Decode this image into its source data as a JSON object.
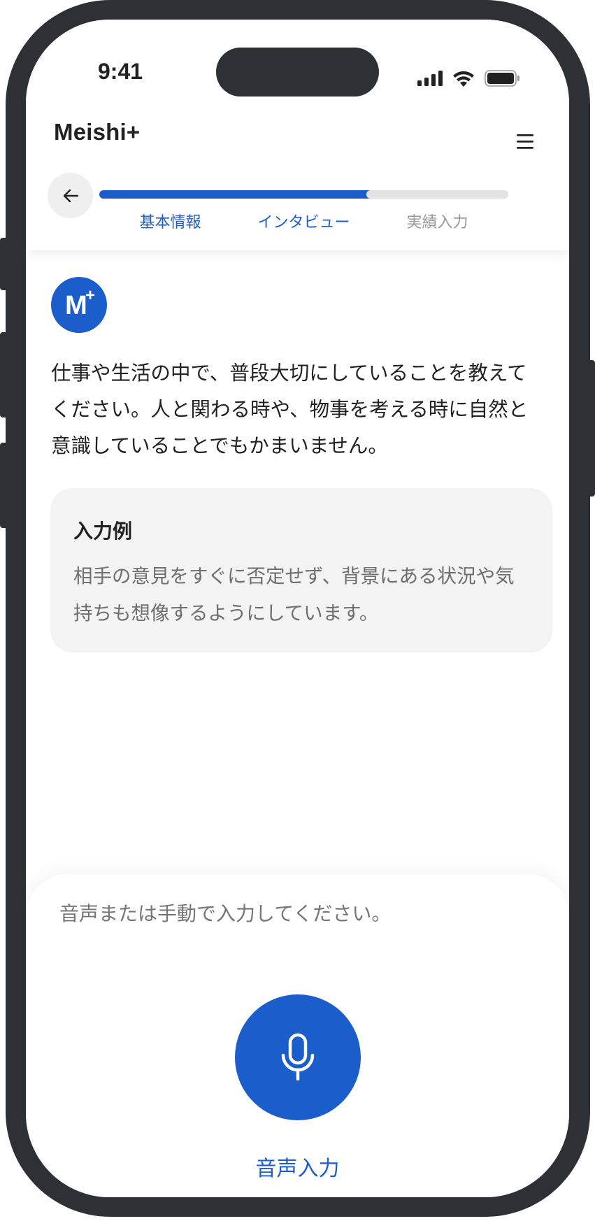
{
  "status_bar": {
    "time": "9:41",
    "icons": [
      "signal-icon",
      "wifi-icon",
      "battery-icon"
    ]
  },
  "header": {
    "logo": "Meishi+",
    "menu_icon": "hamburger-menu-icon",
    "back_icon": "arrow-left-icon"
  },
  "progress": {
    "steps": [
      {
        "label": "基本情報",
        "state": "completed"
      },
      {
        "label": "インタビュー",
        "state": "active"
      },
      {
        "label": "実績入力",
        "state": "inactive"
      }
    ]
  },
  "avatar": {
    "letter": "M",
    "badge": "+"
  },
  "question": {
    "text": "仕事や生活の中で、普段大切にしていることを教えてください。人と関わる時や、物事を考える時に自然と意識していることでもかまいません。"
  },
  "example": {
    "title": "入力例",
    "text": "相手の意見をすぐに否定せず、背景にある状況や気持ちも想像するようにしています。"
  },
  "input": {
    "placeholder": "音声または手動で入力してください。",
    "mic_icon": "microphone-icon",
    "mic_label": "音声入力"
  },
  "colors": {
    "accent": "#1a5dcb",
    "frame": "#2d3035",
    "card_bg": "#f3f3f3",
    "inactive_bar": "#e3e3e3",
    "placeholder": "#8e8e8e"
  }
}
